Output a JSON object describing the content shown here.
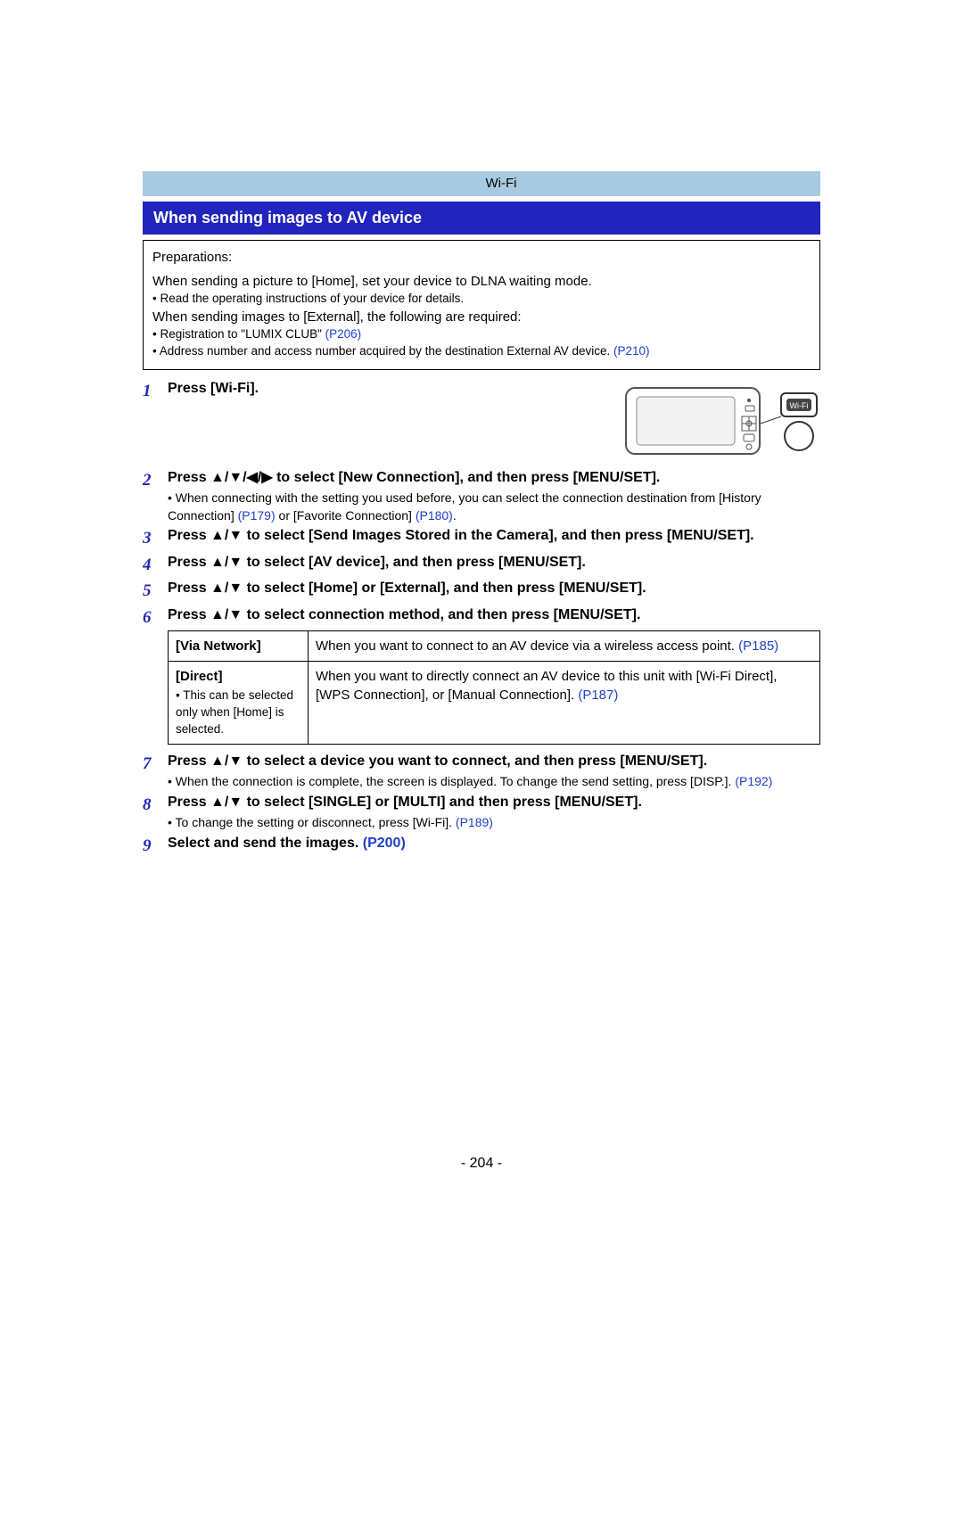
{
  "header": {
    "tab_label": "Wi-Fi"
  },
  "section": {
    "heading": "When sending images to AV device"
  },
  "prep": {
    "label": "Preparations:",
    "line1": "When sending a picture to [Home], set your device to DLNA waiting mode.",
    "line2": "• Read the operating instructions of your device for details.",
    "line3": "When sending images to [External], the following are required:",
    "line4a": "• Registration to \"LUMIX CLUB\" ",
    "line4link": "(P206)",
    "line5a": "• Address number and access number acquired by the destination External AV device. ",
    "line5link": "(P210)"
  },
  "steps": {
    "s1": {
      "num": "1",
      "bold": "Press [Wi-Fi]."
    },
    "s2": {
      "num": "2",
      "bold": "Press ▲/▼/◀/▶ to select [New Connection], and then press [MENU/SET].",
      "n1a": "• When connecting with the setting you used before, you can select the connection destination from [History Connection] ",
      "n1l1": "(P179)",
      "n1b": " or [Favorite Connection] ",
      "n1l2": "(P180)",
      "n1c": "."
    },
    "s3": {
      "num": "3",
      "bold": "Press ▲/▼ to select [Send Images Stored in the Camera], and then press [MENU/SET]."
    },
    "s4": {
      "num": "4",
      "bold": "Press ▲/▼ to select [AV device], and then press [MENU/SET]."
    },
    "s5": {
      "num": "5",
      "bold": "Press ▲/▼ to select [Home] or [External], and then press [MENU/SET]."
    },
    "s6": {
      "num": "6",
      "bold": "Press ▲/▼ to select connection method, and then press [MENU/SET]."
    },
    "s7": {
      "num": "7",
      "bold": "Press ▲/▼ to select a device you want to connect, and then press [MENU/SET].",
      "n1a": "• When the connection is complete, the screen is displayed. To change the send setting, press [DISP.]. ",
      "n1l": "(P192)"
    },
    "s8": {
      "num": "8",
      "bold": "Press ▲/▼ to select [SINGLE] or [MULTI] and then press [MENU/SET].",
      "n1a": "• To change the setting or disconnect, press [Wi-Fi]. ",
      "n1l": "(P189)"
    },
    "s9": {
      "num": "9",
      "bolda": "Select and send the images. ",
      "boldlink": "(P200)"
    }
  },
  "table": {
    "r1": {
      "opt": "[Via Network]",
      "body": "When you want to connect to an AV device via a wireless access point. ",
      "link": "(P185)"
    },
    "r2": {
      "opt": "[Direct]",
      "optnote": "• This can be selected only when [Home] is selected.",
      "body": "When you want to directly connect an AV device to this unit with [Wi-Fi Direct], [WPS Connection], or [Manual Connection]. ",
      "link": "(P187)"
    }
  },
  "page_number": "- 204 -",
  "icons": {
    "wifi_label": "Wi-Fi"
  }
}
